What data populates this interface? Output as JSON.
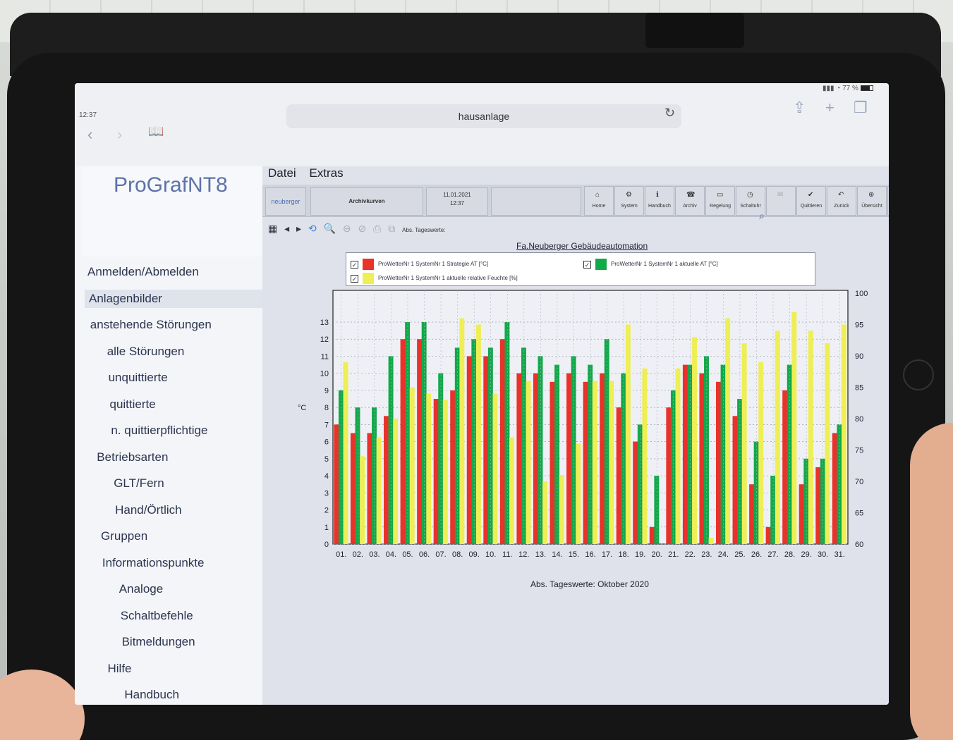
{
  "status": {
    "time": "12:37",
    "battery": "77 %"
  },
  "browser": {
    "url": "hausanlage",
    "reload_icon": "reload-icon",
    "back_icon": "chevron-left-icon",
    "forward_icon": "chevron-right-icon",
    "bookmarks_icon": "book-icon"
  },
  "app": {
    "logo": "ProGrafNT8",
    "menubar": [
      "Datei",
      "Extras"
    ],
    "toolbar": {
      "user": "neuberger",
      "title": "Archivkurven",
      "date": "11.01.2021",
      "time": "12:37",
      "buttons": [
        "Home",
        "System",
        "Handbuch",
        "Archiv",
        "Regelung",
        "Schaltuhr",
        "",
        "Quittieren",
        "Zurück",
        "Übersicht",
        "W"
      ]
    },
    "subtools_label": "Abs. Tageswerte:"
  },
  "sidebar": {
    "items": [
      {
        "label": "Anmelden/Abmelden",
        "level": 0
      },
      {
        "label": "Anlagenbilder",
        "level": 0,
        "active": true
      },
      {
        "label": "anstehende Störungen",
        "level": 0
      },
      {
        "label": "alle Störungen",
        "level": 1
      },
      {
        "label": "unquittierte",
        "level": 1
      },
      {
        "label": "quittierte",
        "level": 1
      },
      {
        "label": "n. quittierpflichtige",
        "level": 1
      },
      {
        "label": "Betriebsarten",
        "level": 0
      },
      {
        "label": "GLT/Fern",
        "level": 1
      },
      {
        "label": "Hand/Örtlich",
        "level": 1
      },
      {
        "label": "Gruppen",
        "level": 0
      },
      {
        "label": "Informationspunkte",
        "level": 0
      },
      {
        "label": "Analoge",
        "level": 1
      },
      {
        "label": "Schaltbefehle",
        "level": 1
      },
      {
        "label": "Bitmeldungen",
        "level": 1
      },
      {
        "label": "Hilfe",
        "level": 0
      },
      {
        "label": "Handbuch",
        "level": 1
      }
    ]
  },
  "chart_data": {
    "type": "bar",
    "title": "Fa.Neuberger Gebäudeautomation",
    "xlabel": "Abs. Tageswerte: Oktober 2020",
    "ylabel": "°C",
    "ylim": [
      0,
      13
    ],
    "y2lim": [
      60,
      100
    ],
    "y2ticks": [
      60,
      65,
      70,
      75,
      80,
      85,
      90,
      95,
      100
    ],
    "categories": [
      "01.",
      "02.",
      "03.",
      "04.",
      "05.",
      "06.",
      "07.",
      "08.",
      "09.",
      "10.",
      "11.",
      "12.",
      "13.",
      "14.",
      "15.",
      "16.",
      "17.",
      "18.",
      "19.",
      "20.",
      "21.",
      "22.",
      "23.",
      "24.",
      "25.",
      "26.",
      "27.",
      "28.",
      "29.",
      "30.",
      "31."
    ],
    "series": [
      {
        "name": "ProWetterNr 1 SystemNr 1 Strategie AT [°C]",
        "color": "#e8322a",
        "axis": "left",
        "values": [
          7,
          6.5,
          6.5,
          7.5,
          12,
          12,
          8.5,
          9,
          11,
          11,
          12,
          10,
          10,
          9.5,
          10,
          9.5,
          10,
          8,
          6,
          1,
          8,
          10.5,
          10,
          9.5,
          7.5,
          3.5,
          1,
          9,
          3.5,
          4.5,
          6.5
        ]
      },
      {
        "name": "ProWetterNr 1 SystemNr 1 aktuelle AT [°C]",
        "color": "#13a84a",
        "axis": "left",
        "values": [
          9,
          8,
          8,
          11,
          13,
          13,
          10,
          11.5,
          12,
          11.5,
          13,
          11.5,
          11,
          10.5,
          11,
          10.5,
          12,
          10,
          7,
          4,
          9,
          10.5,
          11,
          10.5,
          8.5,
          6,
          4,
          10.5,
          5,
          5,
          7
        ]
      },
      {
        "name": "ProWetterNr 1 SystemNr 1 aktuelle relative Feuchte [%]",
        "color": "#eeee55",
        "axis": "right",
        "values": [
          89,
          74,
          77,
          80,
          85,
          84,
          83,
          96,
          95,
          84,
          77,
          86,
          70,
          71,
          76,
          86,
          86,
          95,
          88,
          60,
          88,
          93,
          61,
          96,
          92,
          89,
          94,
          97,
          94,
          92,
          95
        ]
      }
    ],
    "legend": "top",
    "grid": true
  }
}
